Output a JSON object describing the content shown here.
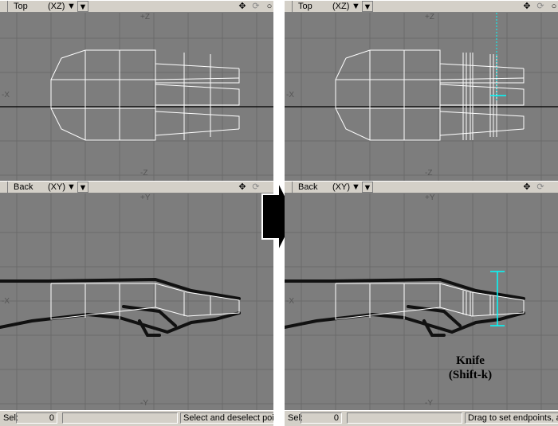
{
  "left_panel": {
    "top_view": {
      "name": "Top",
      "axis": "(XZ)",
      "axis_top": "+Z",
      "axis_bottom": "-Z",
      "axis_left": "-X"
    },
    "back_view": {
      "name": "Back",
      "axis": "(XY)",
      "axis_top": "+Y",
      "axis_bottom": "-Y",
      "axis_left": "-X"
    },
    "status": {
      "sel_label": "Sel:",
      "sel_count": "0",
      "message": "Select and deselect poi"
    }
  },
  "right_panel": {
    "top_view": {
      "name": "Top",
      "axis": "(XZ)",
      "axis_top": "+Z",
      "axis_bottom": "-Z",
      "axis_left": "-X"
    },
    "back_view": {
      "name": "Back",
      "axis": "(XY)",
      "axis_top": "+Y",
      "axis_bottom": "-Y",
      "axis_left": "-X"
    },
    "status": {
      "sel_label": "Sel:",
      "sel_count": "0",
      "message": "Drag to set endpoints, a"
    }
  },
  "caption": {
    "line1": "Knife",
    "line2": "(Shift-k)"
  },
  "icons": {
    "menu": "dropdown-arrow-icon",
    "move": "move-icon",
    "rotate": "rotate-icon"
  },
  "colors": {
    "viewport_bg": "#7d7d7d",
    "grid": "#6b6b6b",
    "mesh": "#ffffff",
    "knife": "#00ffff"
  }
}
